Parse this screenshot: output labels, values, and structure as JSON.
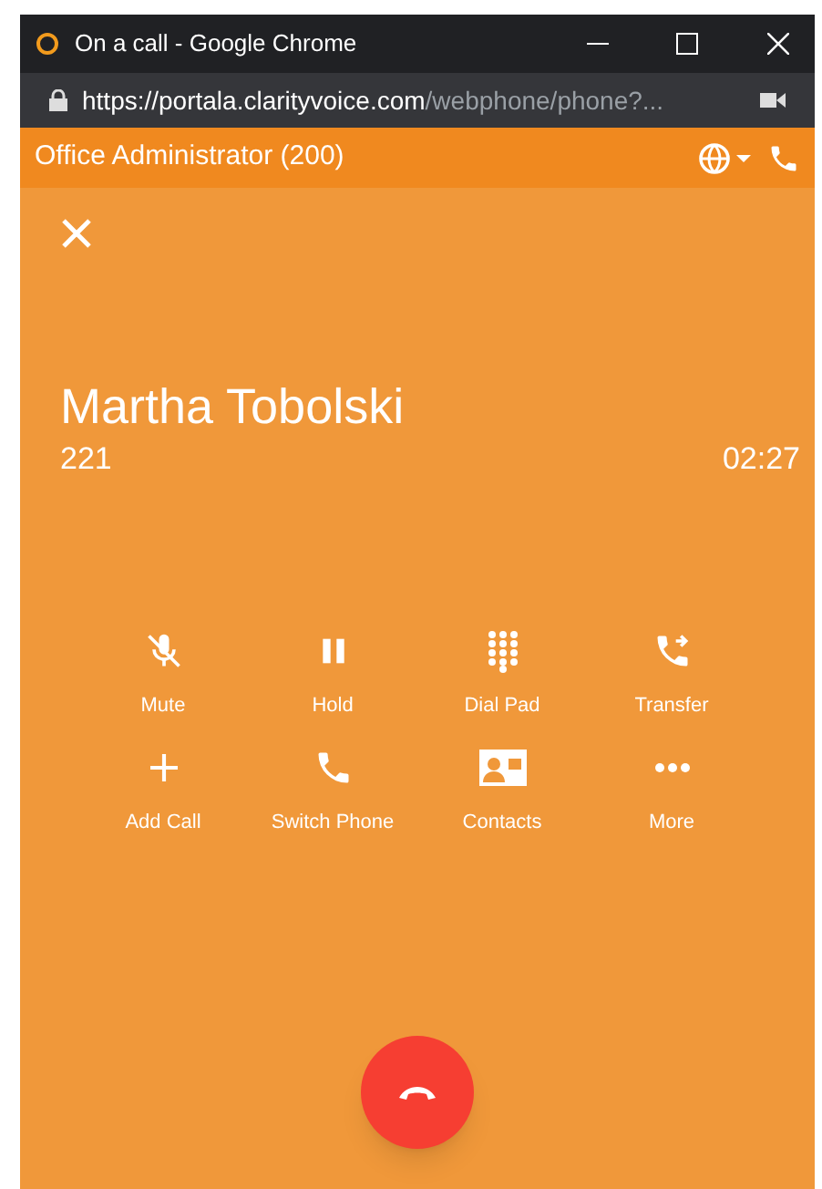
{
  "window": {
    "title": "On a call - Google Chrome"
  },
  "address_bar": {
    "url_host": "https://portala.clarityvoice.com",
    "url_path": "/webphone/phone?..."
  },
  "header": {
    "title": "Office Administrator (200)"
  },
  "call": {
    "name": "Martha Tobolski",
    "number": "221",
    "duration": "02:27"
  },
  "actions": [
    {
      "kind": "mute",
      "label": "Mute"
    },
    {
      "kind": "hold",
      "label": "Hold"
    },
    {
      "kind": "dialpad",
      "label": "Dial Pad"
    },
    {
      "kind": "transfer",
      "label": "Transfer"
    },
    {
      "kind": "add",
      "label": "Add Call"
    },
    {
      "kind": "phone",
      "label": "Switch Phone"
    },
    {
      "kind": "contacts",
      "label": "Contacts"
    },
    {
      "kind": "more",
      "label": "More"
    }
  ]
}
